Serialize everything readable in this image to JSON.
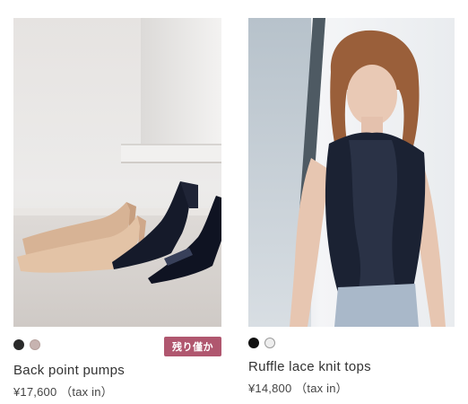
{
  "products": [
    {
      "name": "Back point pumps",
      "price": "¥17,600 （tax in）",
      "badge": "残り僅か",
      "swatches": [
        "#2a2a2a",
        "#c7b3b0"
      ]
    },
    {
      "name": "Ruffle lace knit tops",
      "price": "¥14,800 （tax in）",
      "swatches": [
        "#111111",
        "#eeeeee"
      ]
    }
  ],
  "colors": {
    "badge_bg": "#b0576f"
  }
}
